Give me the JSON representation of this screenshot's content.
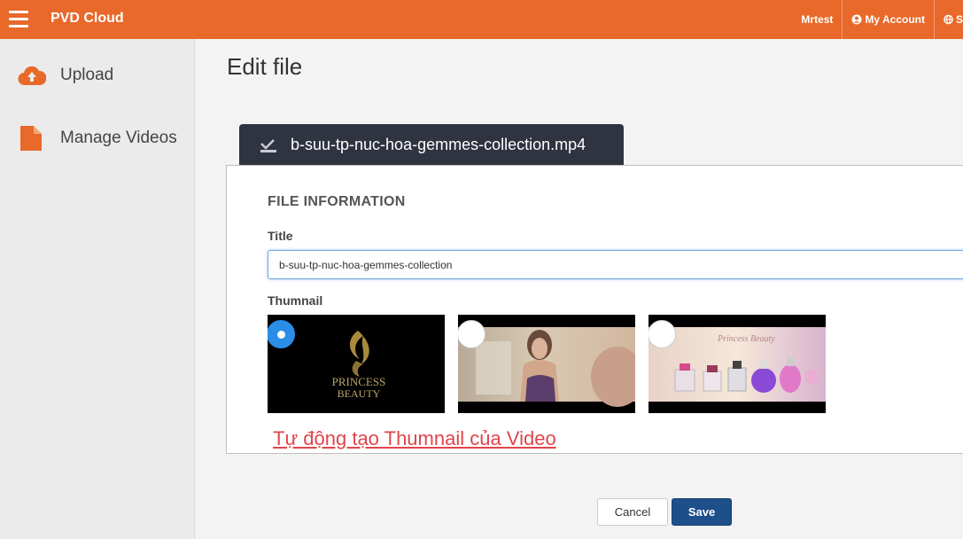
{
  "header": {
    "brand": "PVD Cloud",
    "user": "Mrtest",
    "account": "My Account",
    "settings_cut": "S"
  },
  "sidebar": {
    "items": [
      {
        "label": "Upload",
        "icon": "cloud-upload-icon"
      },
      {
        "label": "Manage Videos",
        "icon": "file-icon"
      }
    ]
  },
  "main": {
    "page_title": "Edit file",
    "file_tab": "b-suu-tp-nuc-hoa-gemmes-collection.mp4",
    "section_title": "FILE INFORMATION",
    "title_label": "Title",
    "title_value": "b-suu-tp-nuc-hoa-gemmes-collection",
    "thumb_label": "Thumnail",
    "thumb1_text_1": "PRINCESS",
    "thumb1_text_2": "BEAUTY",
    "thumb3_text": "Princess Beauty",
    "annotation": "Tự động tạo Thumnail của Video",
    "cancel_label": "Cancel",
    "save_label": "Save"
  },
  "colors": {
    "topbar": "#e8692a",
    "accent_blue": "#2b8de8",
    "save_button": "#1d4f8a",
    "annotation": "#e0454b"
  }
}
